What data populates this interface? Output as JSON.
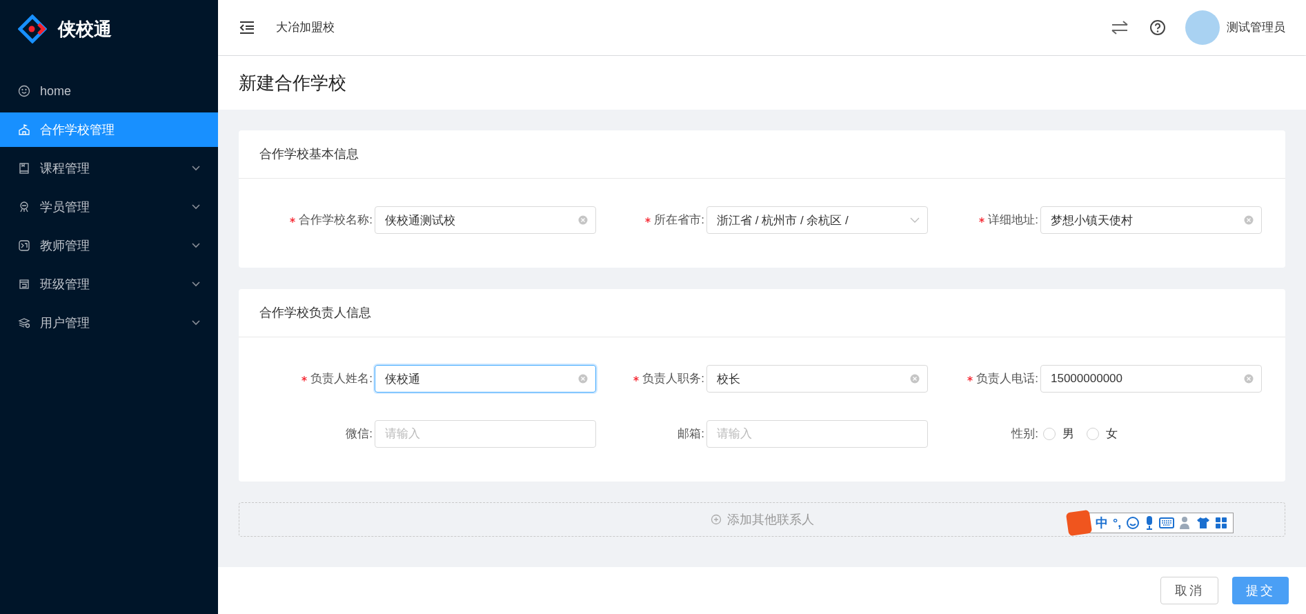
{
  "sidebar": {
    "logo_text": "侠校通",
    "items": [
      {
        "label": "home",
        "kind": "smile",
        "selected": false,
        "expandable": false
      },
      {
        "label": "合作学校管理",
        "kind": "school",
        "selected": true,
        "expandable": false
      },
      {
        "label": "课程管理",
        "kind": "book",
        "selected": false,
        "expandable": true
      },
      {
        "label": "学员管理",
        "kind": "students",
        "selected": false,
        "expandable": true
      },
      {
        "label": "教师管理",
        "kind": "teacher",
        "selected": false,
        "expandable": true
      },
      {
        "label": "班级管理",
        "kind": "class",
        "selected": false,
        "expandable": true
      },
      {
        "label": "用户管理",
        "kind": "users",
        "selected": false,
        "expandable": true
      }
    ]
  },
  "header": {
    "school": "大冶加盟校",
    "user_name": "测试管理员"
  },
  "page_title": "新建合作学校",
  "sections": [
    {
      "title": "合作学校基本信息",
      "fields": [
        {
          "kind": "text",
          "label": "合作学校名称:",
          "required": true,
          "value": "侠校通测试校",
          "focused": false
        },
        {
          "kind": "cascader",
          "label": "所在省市:",
          "required": true,
          "value": "浙江省 / 杭州市 / 余杭区 /",
          "focused": false
        },
        {
          "kind": "text",
          "label": "详细地址:",
          "required": true,
          "value": "梦想小镇天使村",
          "focused": false
        }
      ]
    },
    {
      "title": "合作学校负责人信息",
      "fields": [
        {
          "kind": "text",
          "label": "负责人姓名:",
          "required": true,
          "value": "侠校通",
          "focused": true
        },
        {
          "kind": "text",
          "label": "负责人职务:",
          "required": true,
          "value": "校长",
          "focused": false
        },
        {
          "kind": "text",
          "label": "负责人电话:",
          "required": true,
          "value": "15000000000",
          "focused": false
        },
        {
          "kind": "text",
          "label": "微信:",
          "required": false,
          "placeholder": "请输入",
          "focused": false
        },
        {
          "kind": "text",
          "label": "邮箱:",
          "required": false,
          "placeholder": "请输入",
          "focused": false
        },
        {
          "kind": "radio",
          "label": "性别:",
          "required": false,
          "options": [
            {
              "label": "男",
              "selected": false
            },
            {
              "label": "女",
              "selected": false
            }
          ]
        }
      ]
    }
  ],
  "add_contact": "添加其他联系人",
  "ime_toolbar": {
    "mode": "中",
    "punctuation": "°,"
  },
  "footer": {
    "cancel": "取消",
    "submit": "提交"
  }
}
